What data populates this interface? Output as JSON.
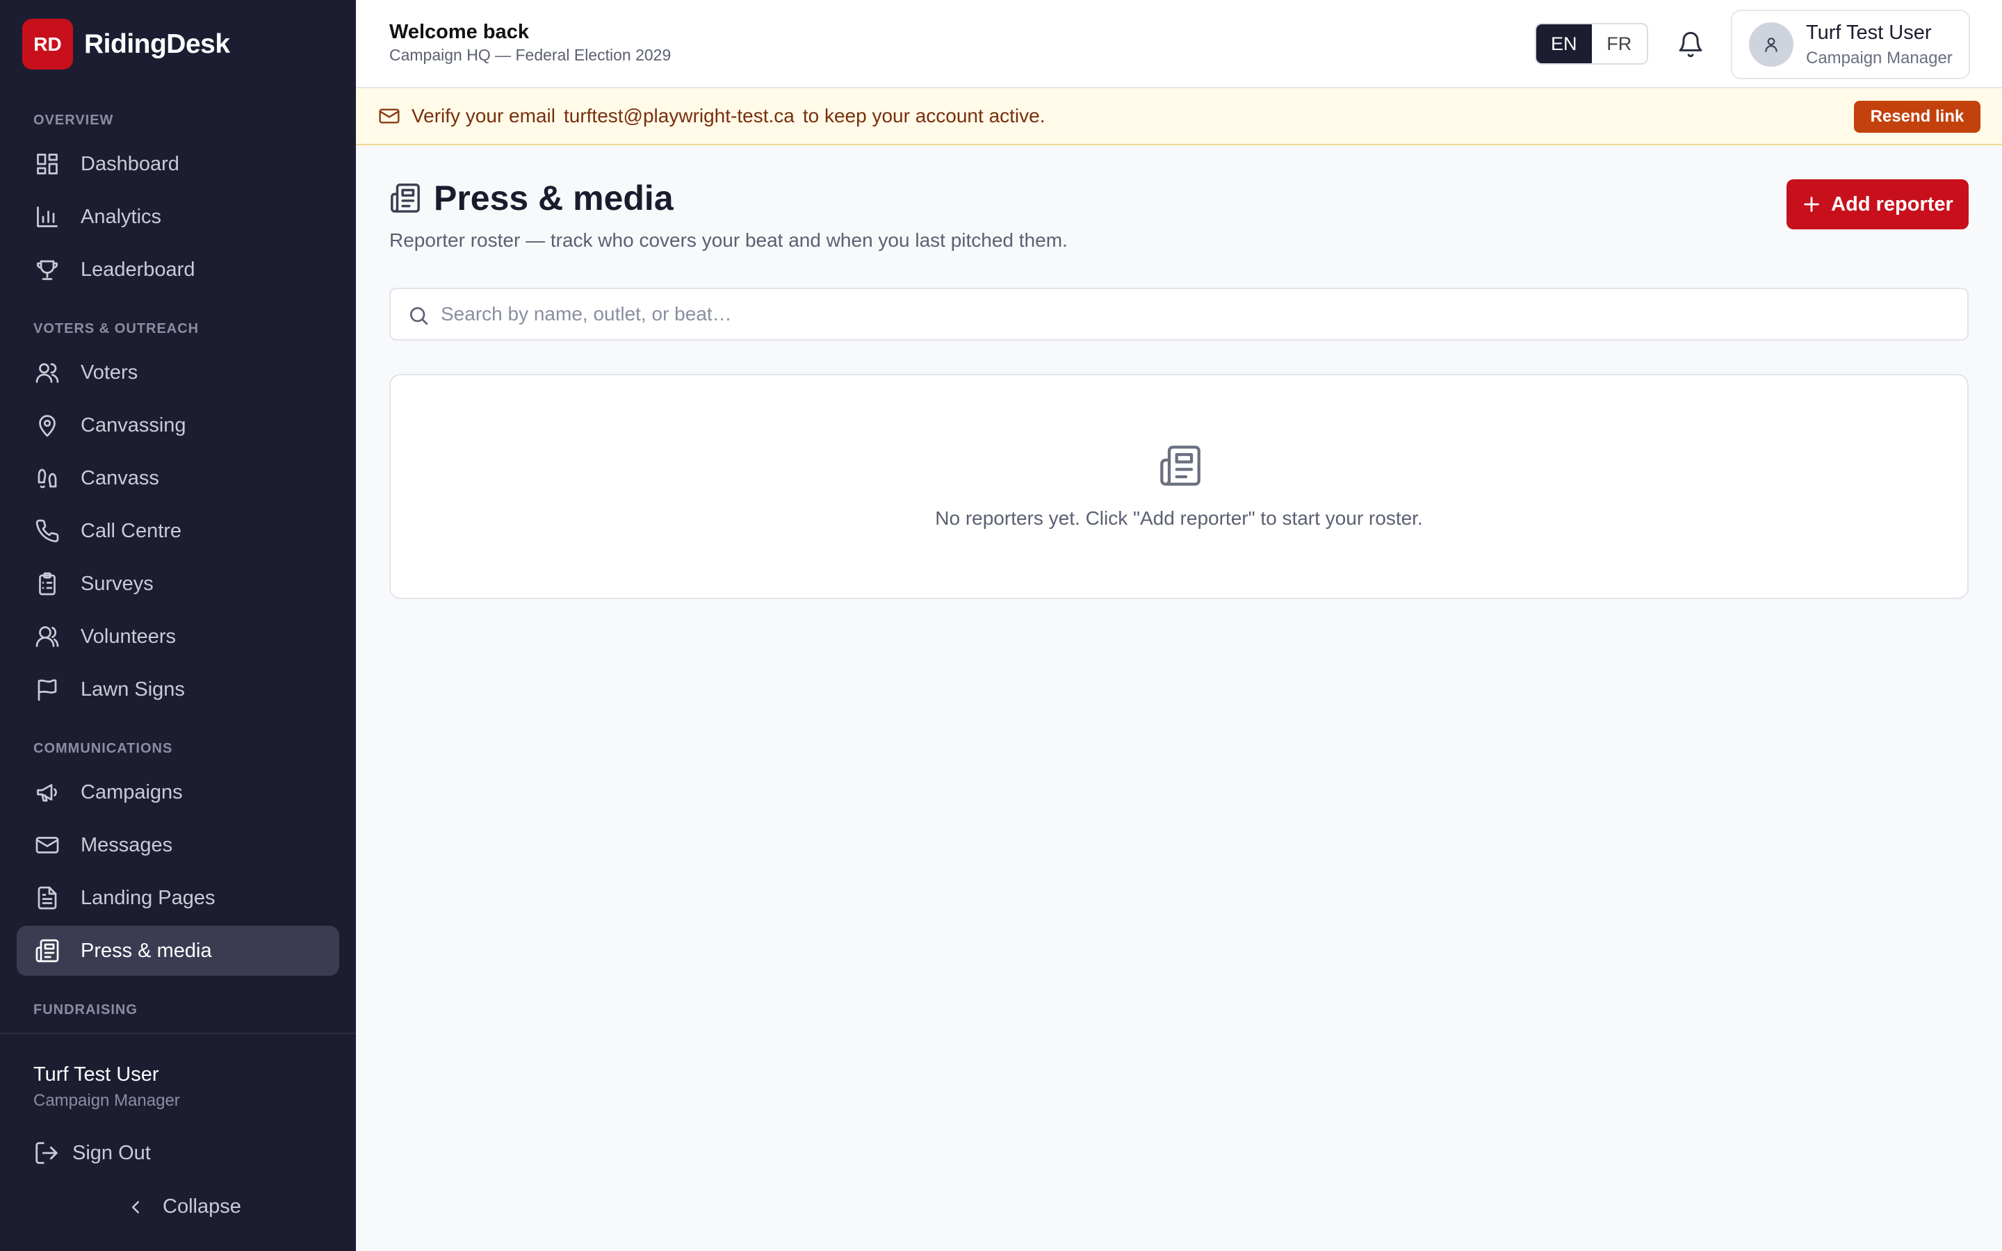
{
  "brand": {
    "logo": "RD",
    "name": "RidingDesk"
  },
  "sidebar": {
    "sections": [
      {
        "label": "OVERVIEW"
      },
      {
        "label": "VOTERS & OUTREACH"
      },
      {
        "label": "COMMUNICATIONS"
      },
      {
        "label": "FUNDRAISING"
      }
    ],
    "items": [
      {
        "label": "Dashboard",
        "icon": "dashboard-icon"
      },
      {
        "label": "Analytics",
        "icon": "bar-chart-icon"
      },
      {
        "label": "Leaderboard",
        "icon": "trophy-icon"
      },
      {
        "label": "Voters",
        "icon": "users-icon"
      },
      {
        "label": "Canvassing",
        "icon": "map-pin-icon"
      },
      {
        "label": "Canvass",
        "icon": "footprints-icon"
      },
      {
        "label": "Call Centre",
        "icon": "phone-icon"
      },
      {
        "label": "Surveys",
        "icon": "clipboard-list-icon"
      },
      {
        "label": "Volunteers",
        "icon": "user-round-icon"
      },
      {
        "label": "Lawn Signs",
        "icon": "flag-icon"
      },
      {
        "label": "Campaigns",
        "icon": "megaphone-icon"
      },
      {
        "label": "Messages",
        "icon": "mail-icon"
      },
      {
        "label": "Landing Pages",
        "icon": "file-text-icon"
      },
      {
        "label": "Press & media",
        "icon": "newspaper-icon",
        "active": true
      }
    ],
    "user": {
      "name": "Turf Test User",
      "role": "Campaign Manager"
    },
    "sign_out": "Sign Out",
    "collapse": "Collapse"
  },
  "header": {
    "welcome": "Welcome back",
    "campaign": "Campaign HQ — Federal Election 2029",
    "lang": {
      "en": "EN",
      "fr": "FR",
      "selected": "EN"
    },
    "user": {
      "name": "Turf Test User",
      "role": "Campaign Manager"
    }
  },
  "banner": {
    "prefix": "Verify your email",
    "email": "turftest@playwright-test.ca",
    "suffix": "to keep your account active.",
    "button": "Resend link"
  },
  "page": {
    "title": "Press & media",
    "subtitle": "Reporter roster — track who covers your beat and when you last pitched them.",
    "add_button": "Add reporter",
    "search_placeholder": "Search by name, outlet, or beat…",
    "search_value": "",
    "empty_text": "No reporters yet. Click \"Add reporter\" to start your roster."
  },
  "colors": {
    "sidebar_bg": "#1c1d31",
    "brand_red": "#c8101c",
    "banner_bg": "#fffbe8",
    "resend_orange": "#c2410c"
  }
}
